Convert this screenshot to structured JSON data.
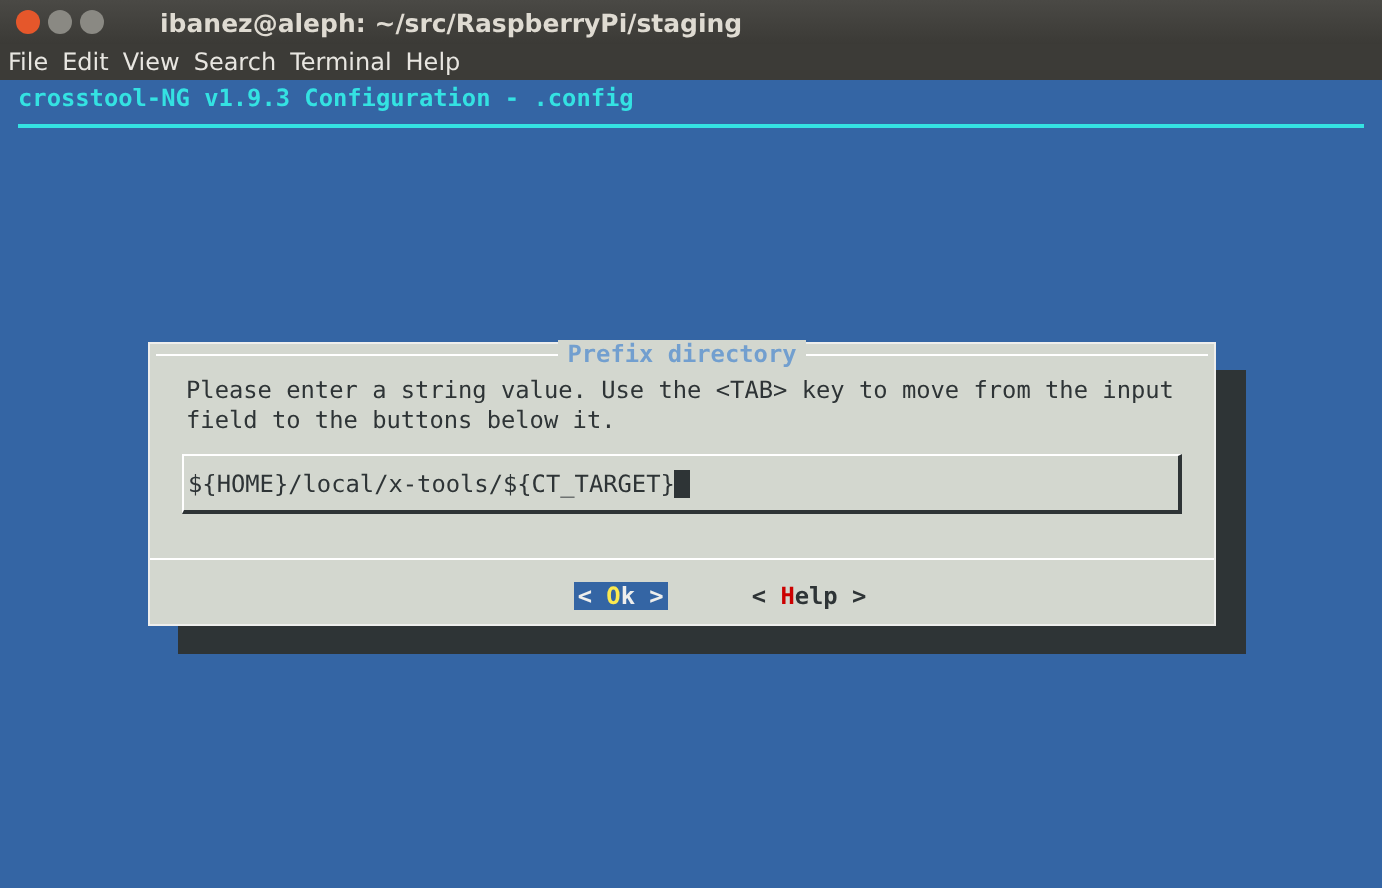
{
  "window": {
    "title": "ibanez@aleph: ~/src/RaspberryPi/staging"
  },
  "menu": [
    "File",
    "Edit",
    "View",
    "Search",
    "Terminal",
    "Help"
  ],
  "header": "crosstool-NG v1.9.3 Configuration - .config",
  "dialog": {
    "title": "Prefix directory",
    "message": "Please enter a string value. Use the <TAB> key to move from the input field to the buttons below it.",
    "value": "${HOME}/local/x-tools/${CT_TARGET}",
    "buttons": [
      {
        "open": "<",
        "hotkey": "O",
        "rest": "k",
        "close": ">",
        "selected": true
      },
      {
        "open": "<",
        "hotkey": "H",
        "rest": "elp",
        "close": ">",
        "selected": false
      }
    ]
  }
}
